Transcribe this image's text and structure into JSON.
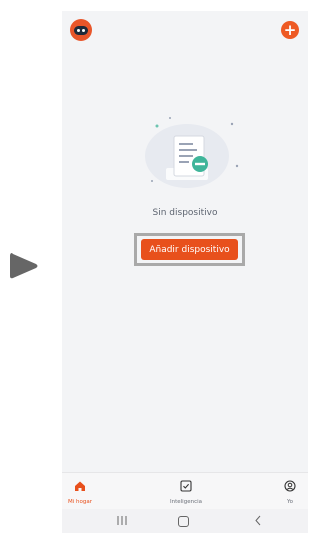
{
  "empty_state": {
    "message": "Sin dispositivo",
    "add_device_label": "Añadir dispositivo"
  },
  "tabs": [
    {
      "label": "Mi hogar",
      "icon": "home-icon",
      "active": true
    },
    {
      "label": "Inteligencia",
      "icon": "checkbox-icon",
      "active": false
    },
    {
      "label": "Yo",
      "icon": "profile-icon",
      "active": false
    }
  ],
  "header": {
    "add_icon": "plus-icon"
  },
  "colors": {
    "accent": "#e8501c",
    "background": "#f3f4f6",
    "illustration_teal": "#3fb59a"
  },
  "system_nav": {
    "recents": "|||",
    "back": "<"
  }
}
